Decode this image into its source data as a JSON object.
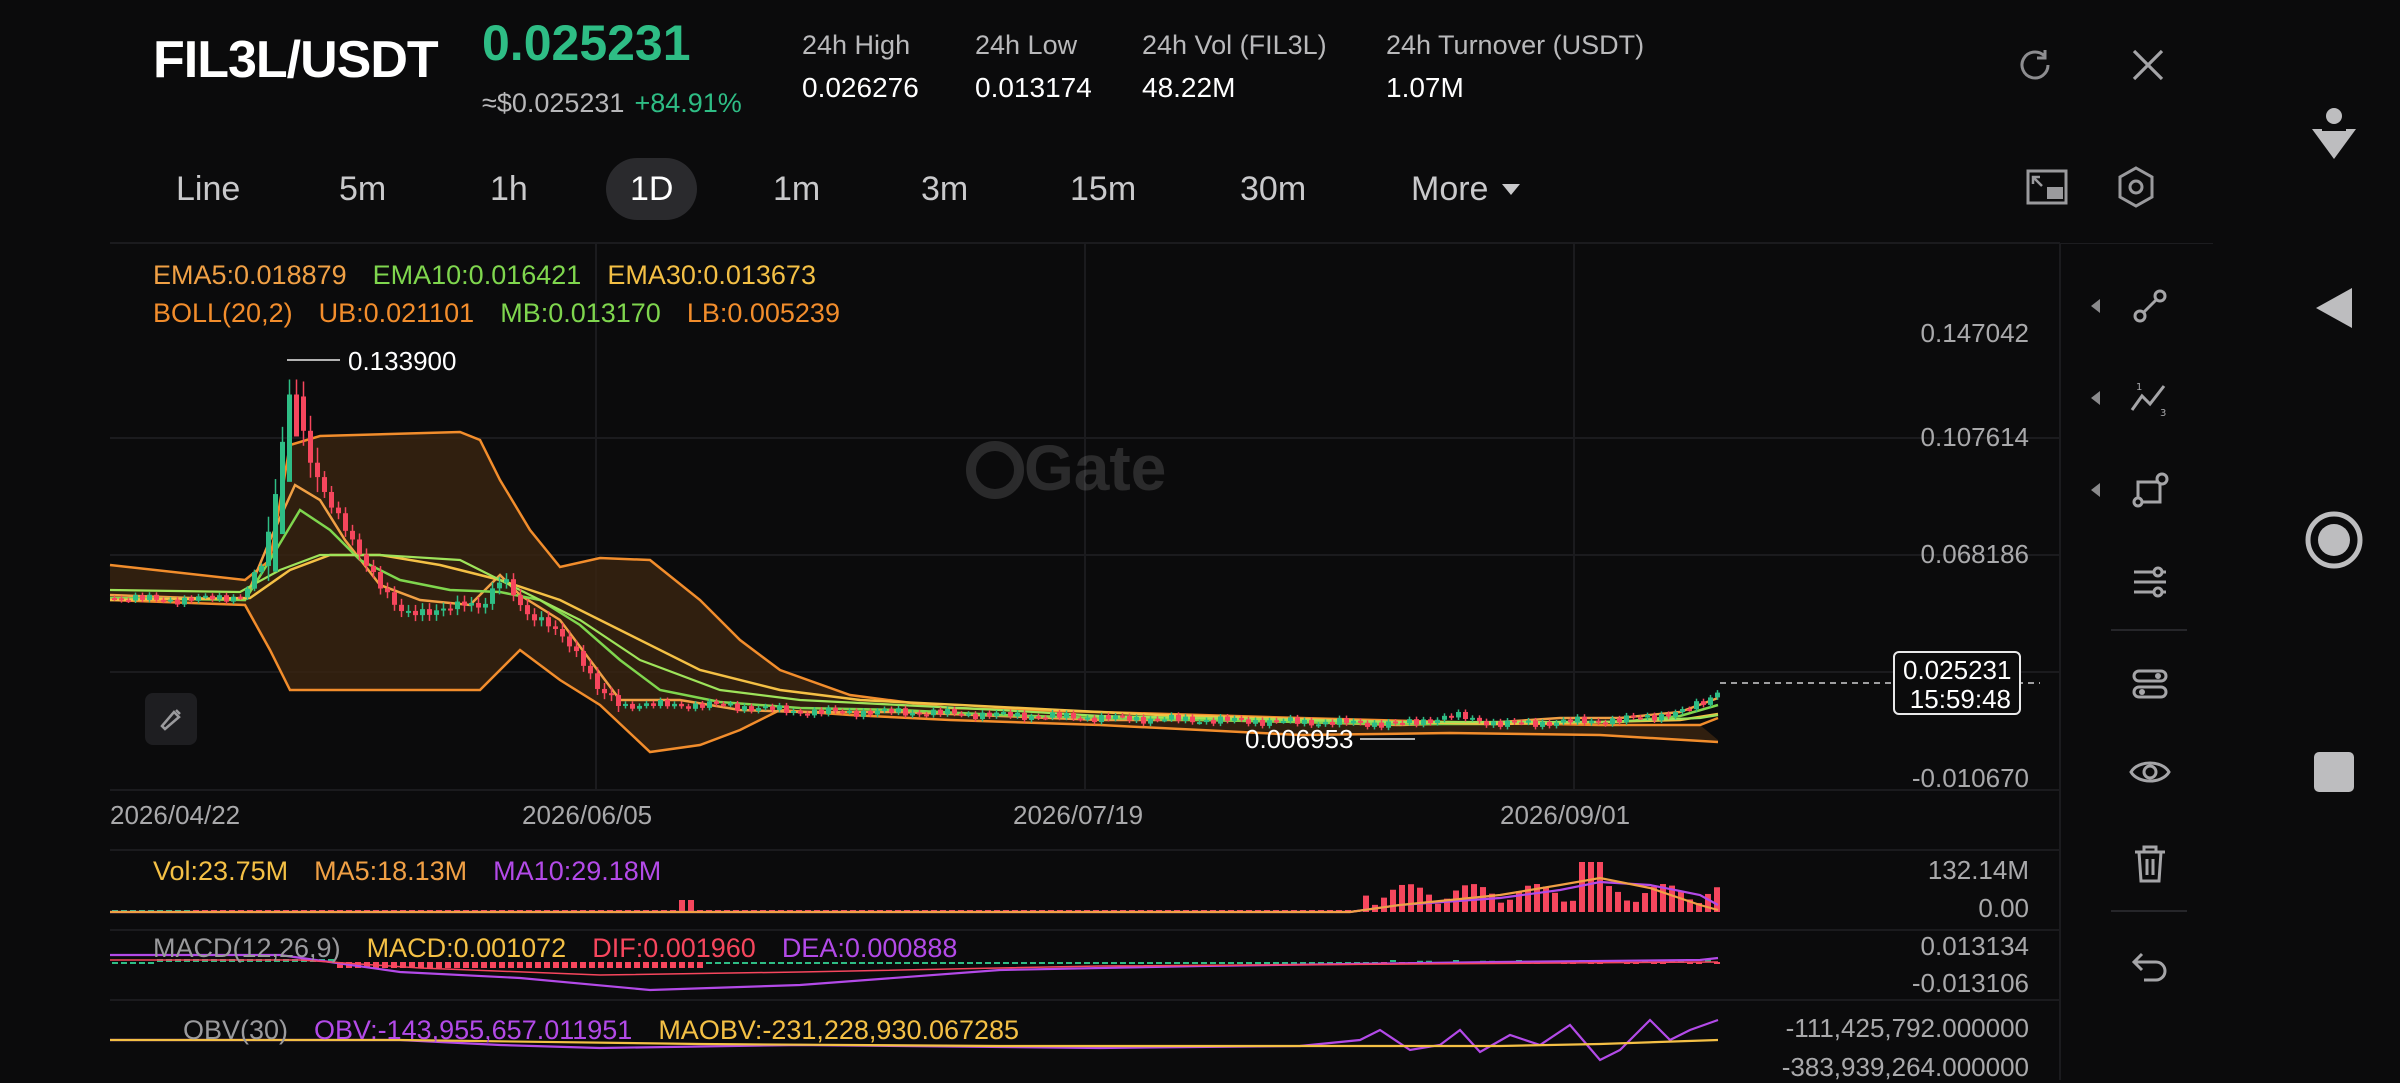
{
  "header": {
    "pair": "FIL3L/USDT",
    "price": "0.025231",
    "usd_price": "≈$0.025231",
    "change": "+84.91%",
    "stats": [
      {
        "label": "24h   High",
        "value": "0.026276"
      },
      {
        "label": "24h   Low",
        "value": "0.013174"
      },
      {
        "label": "24h   Vol (FIL3L)",
        "value": "48.22M"
      },
      {
        "label": "24h   Turnover (USDT)",
        "value": "1.07M"
      }
    ]
  },
  "tabs": [
    "Line",
    "5m",
    "1h",
    "1D",
    "1m",
    "3m",
    "15m",
    "30m",
    "More"
  ],
  "active_tab": "1D",
  "legend": {
    "ema5": "EMA5:0.018879",
    "ema10": "EMA10:0.016421",
    "ema30": "EMA30:0.013673",
    "boll": "BOLL(20,2)",
    "ub": "UB:0.021101",
    "mb": "MB:0.013170",
    "lb": "LB:0.005239"
  },
  "price_axis": [
    "0.147042",
    "0.107614",
    "0.068186",
    "-0.010670"
  ],
  "high_marker": "0.133900",
  "low_marker": "0.006953",
  "last_price_tag": {
    "price": "0.025231",
    "countdown": "15:59:48"
  },
  "dates": [
    "2026/04/22",
    "2026/06/05",
    "2026/07/19",
    "2026/09/01"
  ],
  "volume": {
    "vol": "Vol:23.75M",
    "ma5": "MA5:18.13M",
    "ma10": "MA10:29.18M",
    "axis_top": "132.14M",
    "axis_bottom": "0.00"
  },
  "macd": {
    "label": "MACD(12,26,9)",
    "macd": "MACD:0.001072",
    "dif": "DIF:0.001960",
    "dea": "DEA:0.000888",
    "axis_top": "0.013134",
    "axis_bottom": "-0.013106"
  },
  "obv": {
    "label": "OBV(30)",
    "obv": "OBV:-143,955,657.011951",
    "maobv": "MAOBV:-231,228,930.067285",
    "axis_top": "-111,425,792.000000",
    "axis_bottom": "-383,939,264.000000"
  },
  "watermark": "Gate",
  "colors": {
    "up": "#2ebd85",
    "down": "#f6465d",
    "ema5": "#f0a045",
    "ema10": "#7fd64e",
    "ema30": "#f4c045",
    "boll": "#f28d2c",
    "purple": "#b34ae8"
  }
}
